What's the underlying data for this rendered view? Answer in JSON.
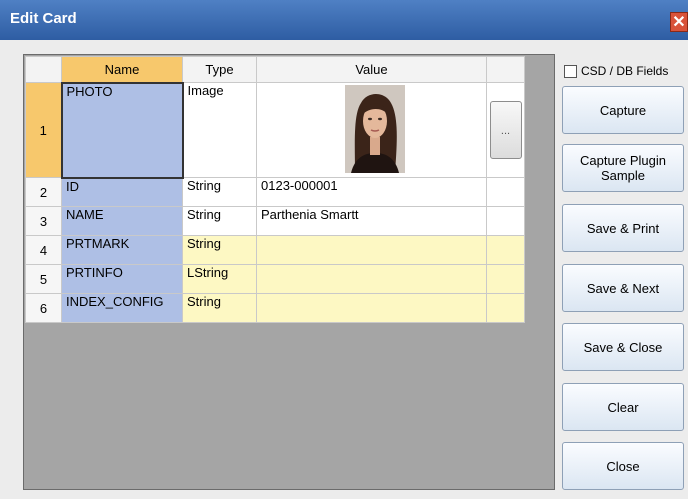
{
  "window": {
    "title": "Edit Card",
    "close_glyph": "✕"
  },
  "checkbox": {
    "label": "CSD / DB Fields",
    "checked": false
  },
  "grid": {
    "columns": [
      "Name",
      "Type",
      "Value"
    ],
    "ellipsis": "...",
    "rows": [
      {
        "num": "1",
        "name": "PHOTO",
        "type": "Image",
        "value": ""
      },
      {
        "num": "2",
        "name": "ID",
        "type": "String",
        "value": "0123-000001"
      },
      {
        "num": "3",
        "name": "NAME",
        "type": "String",
        "value": "Parthenia Smartt"
      },
      {
        "num": "4",
        "name": "PRTMARK",
        "type": "String",
        "value": ""
      },
      {
        "num": "5",
        "name": "PRTINFO",
        "type": "LString",
        "value": ""
      },
      {
        "num": "6",
        "name": "INDEX_CONFIG",
        "type": "String",
        "value": ""
      }
    ]
  },
  "buttons": {
    "capture": "Capture",
    "capture_plugin": "Capture Plugin Sample",
    "save_print": "Save & Print",
    "save_next": "Save & Next",
    "save_close": "Save & Close",
    "clear": "Clear",
    "close": "Close"
  },
  "colors": {
    "title_bar": "#2e5da3",
    "selected_header": "#f7c86c",
    "name_cell": "#aebfe5",
    "editable_row": "#fdf8c3"
  }
}
